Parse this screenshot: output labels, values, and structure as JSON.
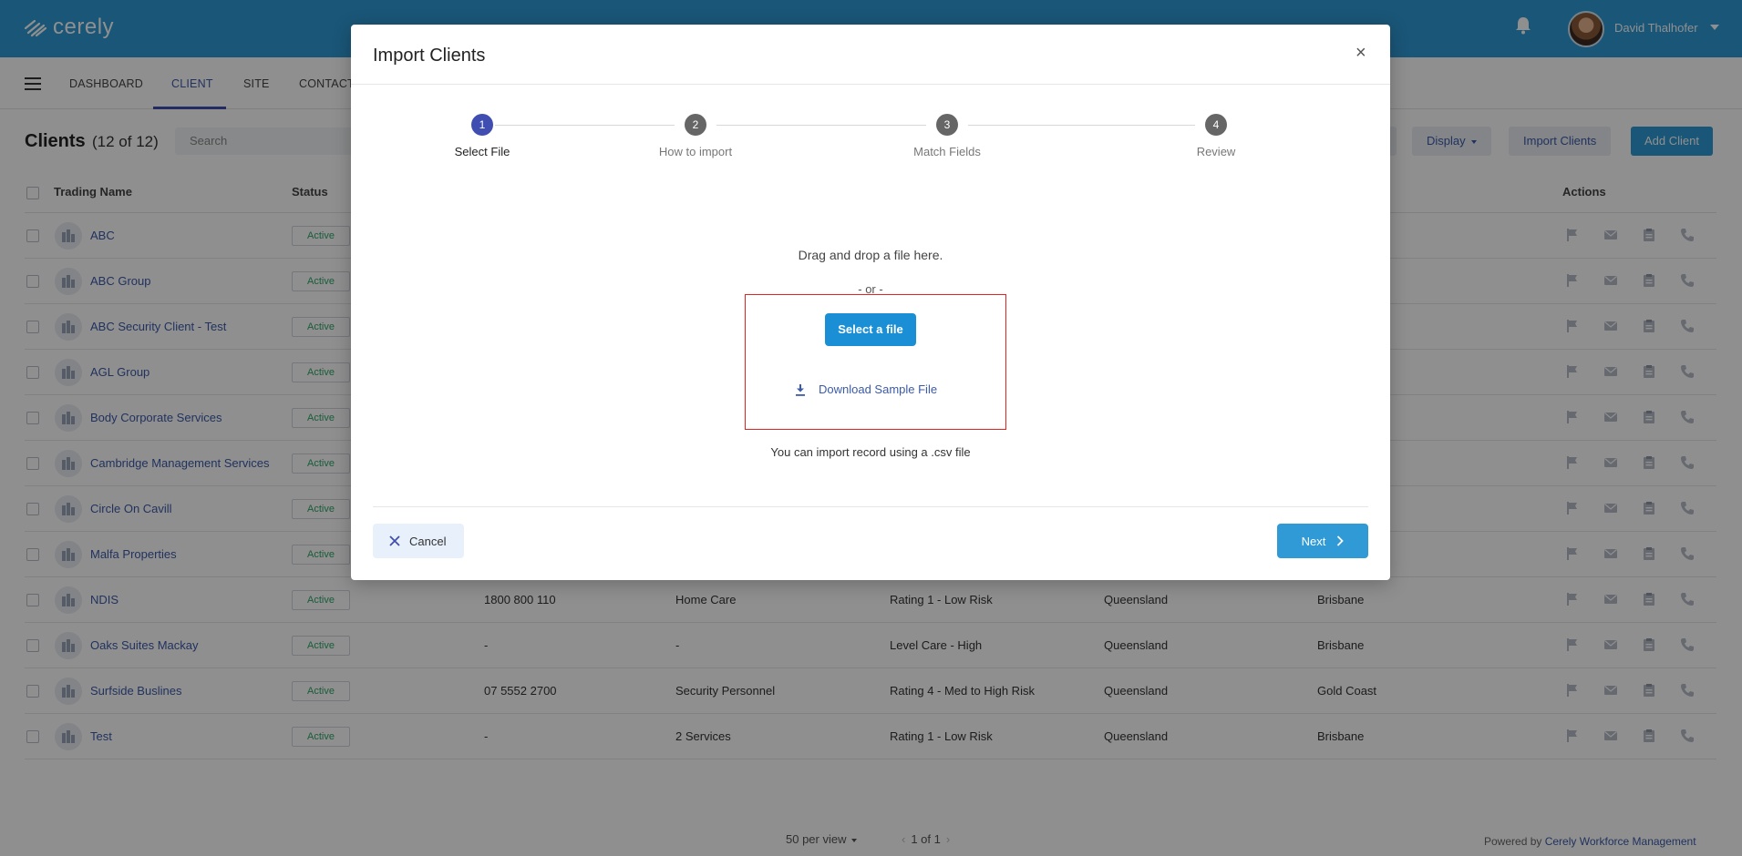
{
  "app": {
    "logo_text": "cerely",
    "user_name": "David Thalhofer"
  },
  "nav": {
    "items": [
      "DASHBOARD",
      "CLIENT",
      "SITE",
      "CONTACT"
    ],
    "active": "CLIENT"
  },
  "page": {
    "title": "Clients",
    "count": "(12 of 12)",
    "search_placeholder": "Search"
  },
  "toolbar": {
    "display_label": "Display",
    "import_label": "Import Clients",
    "add_label": "Add Client"
  },
  "table": {
    "columns": {
      "trading_name": "Trading Name",
      "status": "Status",
      "actions": "Actions"
    },
    "rows": [
      {
        "name": "ABC",
        "status": "Active",
        "phone": "",
        "service": "",
        "rating": "",
        "state": "",
        "city": ""
      },
      {
        "name": "ABC Group",
        "status": "Active",
        "phone": "",
        "service": "",
        "rating": "",
        "state": "",
        "city": ""
      },
      {
        "name": "ABC Security Client - Test",
        "status": "Active",
        "phone": "",
        "service": "",
        "rating": "",
        "state": "",
        "city": ""
      },
      {
        "name": "AGL Group",
        "status": "Active",
        "phone": "",
        "service": "",
        "rating": "",
        "state": "",
        "city": ""
      },
      {
        "name": "Body Corporate Services",
        "status": "Active",
        "phone": "",
        "service": "",
        "rating": "",
        "state": "",
        "city": ""
      },
      {
        "name": "Cambridge Management Services",
        "status": "Active",
        "phone": "",
        "service": "",
        "rating": "",
        "state": "",
        "city": ""
      },
      {
        "name": "Circle On Cavill",
        "status": "Active",
        "phone": "",
        "service": "",
        "rating": "",
        "state": "",
        "city": ""
      },
      {
        "name": "Malfa Properties",
        "status": "Active",
        "phone": "",
        "service": "",
        "rating": "",
        "state": "",
        "city": ""
      },
      {
        "name": "NDIS",
        "status": "Active",
        "phone": "1800 800 110",
        "service": "Home Care",
        "rating": "Rating 1 - Low Risk",
        "state": "Queensland",
        "city": "Brisbane"
      },
      {
        "name": "Oaks Suites Mackay",
        "status": "Active",
        "phone": "-",
        "service": "-",
        "rating": "Level Care - High",
        "state": "Queensland",
        "city": "Brisbane"
      },
      {
        "name": "Surfside Buslines",
        "status": "Active",
        "phone": "07 5552 2700",
        "service": "Security Personnel",
        "rating": "Rating 4 - Med to High Risk",
        "state": "Queensland",
        "city": "Gold Coast"
      },
      {
        "name": "Test",
        "status": "Active",
        "phone": "-",
        "service": "2 Services",
        "rating": "Rating 1 - Low Risk",
        "state": "Queensland",
        "city": "Brisbane"
      }
    ]
  },
  "footer": {
    "per_view": "50 per view",
    "page_info": "1 of 1",
    "powered_prefix": "Powered by",
    "powered_link": "Cerely Workforce Management"
  },
  "modal": {
    "title": "Import Clients",
    "close": "×",
    "steps": [
      {
        "number": "1",
        "label": "Select File"
      },
      {
        "number": "2",
        "label": "How to import"
      },
      {
        "number": "3",
        "label": "Match Fields"
      },
      {
        "number": "4",
        "label": "Review"
      }
    ],
    "drop_text": "Drag and drop a file here.",
    "or_text": "- or -",
    "select_label": "Select a file",
    "download_label": "Download Sample File",
    "hint": "You can import record using a .csv file",
    "cancel_label": "Cancel",
    "next_label": "Next"
  },
  "colors": {
    "primary": "#2f9ad6",
    "accent": "#3f4eb0",
    "link": "#3b5aa8",
    "status": "#2fa56a",
    "highlight": "#e02424"
  }
}
